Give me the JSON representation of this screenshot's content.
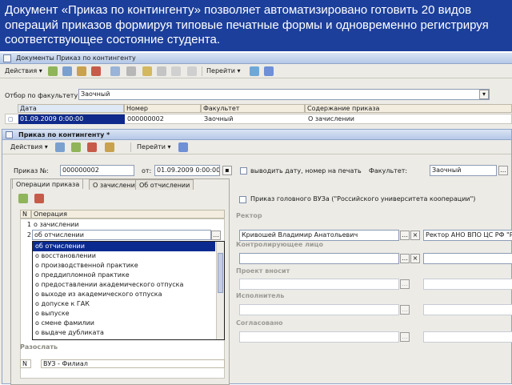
{
  "caption": "Документ «Приказ по контингенту» позволяет автоматизировано  готовить 20 видов операций приказов формируя типовые печатные формы и одновременно регистрируя соответствующее состояние студента.",
  "list_window": {
    "title": "Документы Приказ по контингенту",
    "actions_label": "Действия",
    "goto_label": "Перейти",
    "filter_label": "Отбор по факультету:",
    "filter_value": "Заочный",
    "columns": [
      "Дата",
      "Номер",
      "Факультет",
      "Содержание приказа"
    ],
    "row": {
      "date": "01.09.2009 0:00:00",
      "number": "000000002",
      "faculty": "Заочный",
      "content": "О зачислении"
    }
  },
  "doc_window": {
    "title": "Приказ по контингенту *",
    "actions_label": "Действия",
    "goto_label": "Перейти",
    "order_label": "Приказ №:",
    "order_number": "000000002",
    "from_label": "от:",
    "order_date": "01.09.2009 0:00:00",
    "issue_checkbox_label": "выводить дату, номер на печать",
    "faculty_label": "Факультет:",
    "faculty_value": "Заочный",
    "tabs": [
      "Операции приказа",
      "О зачислении",
      "Об отчислении"
    ],
    "grid_columns": [
      "N",
      "Операция"
    ],
    "rows": [
      {
        "n": "1",
        "op": "о зачислении"
      },
      {
        "n": "2",
        "op": "об отчислении"
      }
    ],
    "dropdown_items": [
      "об отчислении",
      "о восстановлении",
      "о производственной практике",
      "о преддипломной практике",
      "о предоставлении академического отпуска",
      "о выходе из академического отпуска",
      "о допуске к ГАК",
      "о выпуске",
      "о смене фамилии",
      "о выдаче дубликата"
    ],
    "main_uni_checkbox_label": "Приказ головного ВУЗа  (\"Российского университета кооперации\")",
    "rector_label": "Ректор",
    "rector_value": "Кривошей Владимир Анатольевич",
    "rector_title": "Ректор АНО ВПО ЦС РФ \"Р",
    "control_label": "Контролирующее лицо",
    "project_label": "Проект вносит",
    "executor_label": "Исполнитель",
    "agreed_label": "Согласовано",
    "distribution_label": "Разослать",
    "bottom_row": {
      "n": "N",
      "value": "ВУЗ - Филиал"
    }
  }
}
